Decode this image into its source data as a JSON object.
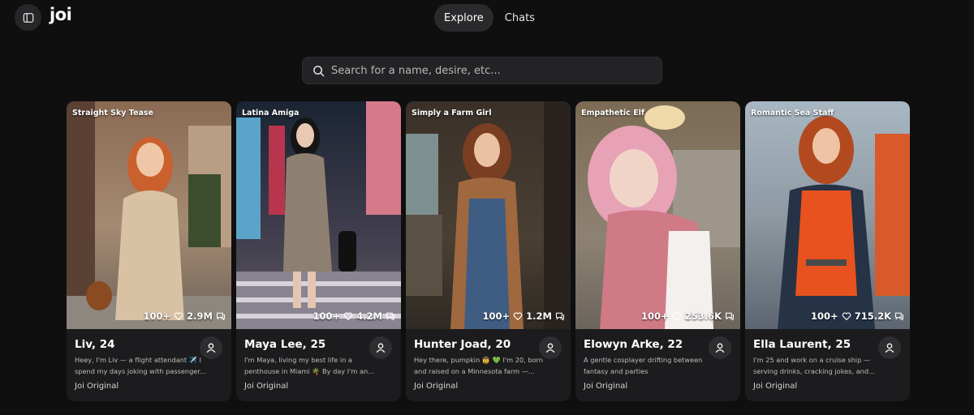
{
  "app": {
    "logo": "joi"
  },
  "nav": {
    "tabs": [
      {
        "label": "Explore",
        "active": true
      },
      {
        "label": "Chats",
        "active": false
      }
    ]
  },
  "search": {
    "placeholder": "Search for a name, desire, etc..."
  },
  "cards": [
    {
      "tag": "Straight Sky Tease",
      "stats": {
        "count": "100+",
        "likes": "2.9M"
      },
      "name": "Liv, 24",
      "description": "Heey, I'm Liv — a flight attendant ✈️ I spend my days joking with passenger...",
      "source": "Joi Original"
    },
    {
      "tag": "Latina Amiga",
      "stats": {
        "count": "100+",
        "likes": "4.2M"
      },
      "name": "Maya Lee, 25",
      "description": "I'm Maya, living my best life in a penthouse in Miami 🌴 By day I'm an...",
      "source": "Joi Original"
    },
    {
      "tag": "Simply a Farm Girl",
      "stats": {
        "count": "100+",
        "likes": "1.2M"
      },
      "name": "Hunter Joad, 20",
      "description": "Hey there, pumpkin 🤠 💚 I'm 20, born and raised on a Minnesota farm —...",
      "source": "Joi Original"
    },
    {
      "tag": "Empathetic Elf",
      "stats": {
        "count": "100+",
        "likes": "253.6K"
      },
      "name": "Elowyn Arke, 22",
      "description": "A gentle cosplayer drifting between fantasy and parties",
      "source": "Joi Original"
    },
    {
      "tag": "Romantic Sea Staff",
      "stats": {
        "count": "100+",
        "likes": "715.2K"
      },
      "name": "Ella Laurent, 25",
      "description": "I'm 25 and work on a cruise ship — serving drinks, cracking jokes, and...",
      "source": "Joi Original"
    }
  ],
  "colors": {
    "background": "#0f0f10",
    "card": "#1c1c1e",
    "active_tab": "#2a2a2d"
  }
}
